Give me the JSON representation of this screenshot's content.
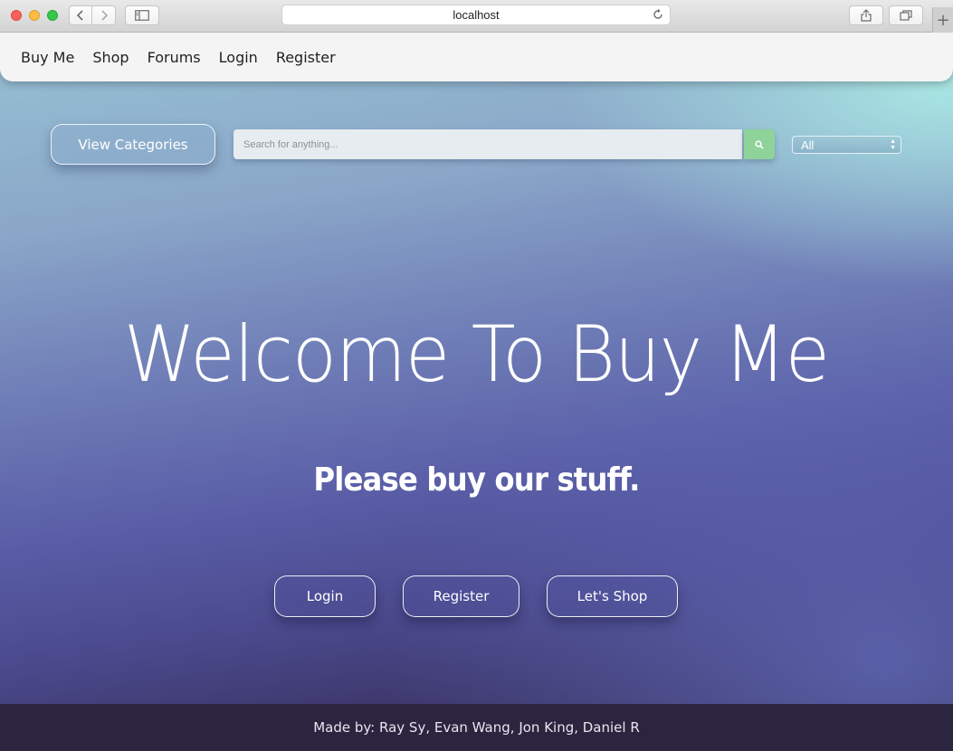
{
  "browser": {
    "url": "localhost",
    "back_icon": "chevron-left-icon",
    "forward_icon": "chevron-right-icon"
  },
  "nav": {
    "links": [
      "Buy Me",
      "Shop",
      "Forums",
      "Login",
      "Register"
    ]
  },
  "toolbar": {
    "view_categories_label": "View Categories",
    "search_placeholder": "Search for anything...",
    "select_value": "All"
  },
  "hero": {
    "title": "Welcome To Buy Me",
    "subtitle": "Please buy our stuff."
  },
  "actions": [
    "Login",
    "Register",
    "Let's Shop"
  ],
  "footer": {
    "text": "Made by: Ray Sy, Evan Wang, Jon King, Daniel R"
  },
  "colors": {
    "search_button": "#8fd39a",
    "footer_bg": "#2c2540",
    "navbar_bg": "#f4f4f4"
  }
}
